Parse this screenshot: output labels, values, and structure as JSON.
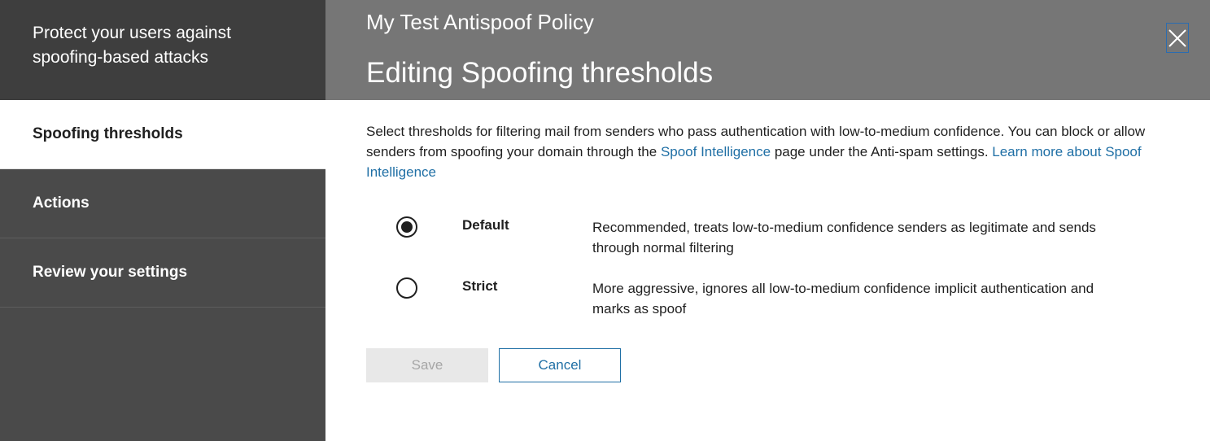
{
  "sidebar": {
    "title": "Protect your users against spoofing-based attacks",
    "items": [
      {
        "label": "Spoofing thresholds",
        "active": true
      },
      {
        "label": "Actions",
        "active": false
      },
      {
        "label": "Review your settings",
        "active": false
      }
    ]
  },
  "header": {
    "policy_name": "My Test Antispoof Policy",
    "title": "Editing Spoofing thresholds",
    "close_icon": "close-icon"
  },
  "description": {
    "part1": "Select thresholds for filtering mail from senders who pass authentication with low-to-medium confidence. You can block or allow senders from spoofing your domain through the ",
    "link1": "Spoof Intelligence",
    "part2": " page under the Anti-spam settings. ",
    "link2": "Learn more about Spoof Intelligence"
  },
  "options": [
    {
      "label": "Default",
      "description": "Recommended, treats low-to-medium confidence senders as legitimate and sends through normal filtering",
      "selected": true
    },
    {
      "label": "Strict",
      "description": "More aggressive, ignores all low-to-medium confidence implicit authentication and marks as spoof",
      "selected": false
    }
  ],
  "buttons": {
    "save_label": "Save",
    "cancel_label": "Cancel"
  },
  "colors": {
    "link": "#1f6fa5",
    "sidebar_bg": "#4a4a4a",
    "header_bg": "#767676"
  }
}
